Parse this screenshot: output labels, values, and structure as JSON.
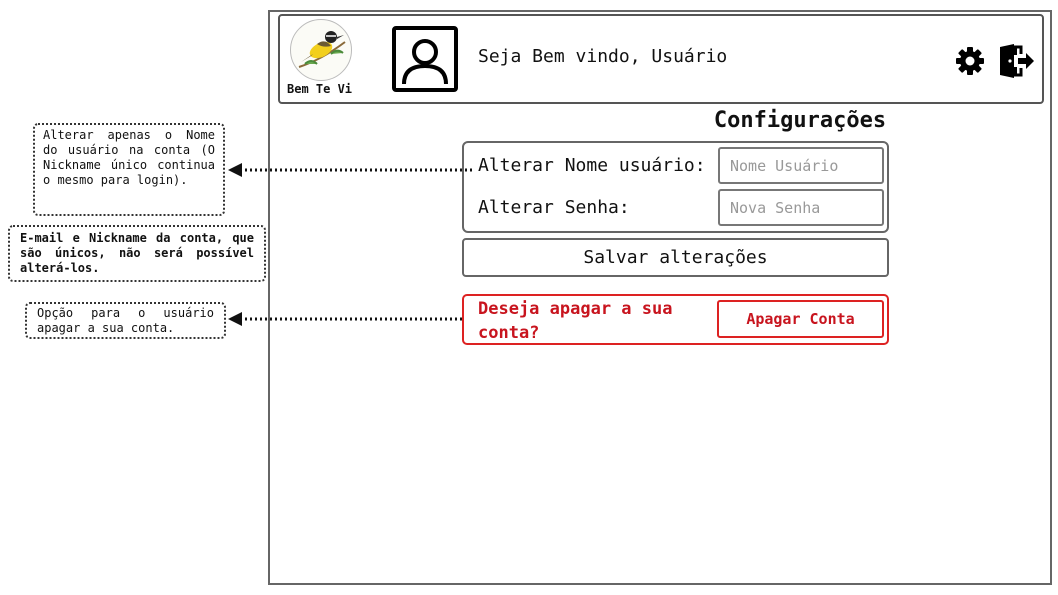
{
  "header": {
    "logo_text": "Bem Te Vi",
    "welcome": "Seja Bem vindo, Usuário",
    "icons": [
      "bird-logo",
      "user-avatar-icon",
      "gear-icon",
      "logout-icon"
    ]
  },
  "page": {
    "title": "Configurações"
  },
  "form": {
    "name_label": "Alterar Nome usuário:",
    "name_placeholder": "Nome Usuário",
    "password_label": "Alterar Senha:",
    "password_placeholder": "Nova Senha",
    "save_label": "Salvar alterações"
  },
  "danger": {
    "question": "Deseja apagar a sua conta?",
    "delete_label": "Apagar Conta",
    "color": "#d22222"
  },
  "notes": {
    "note1": "Alterar apenas o Nome do usuário na conta (O Nickname único continua o mesmo para login).",
    "note2": "E-mail e Nickname da conta, que são únicos, não será possível alterá-los.",
    "note3": "Opção para o usuário apagar a sua conta."
  }
}
